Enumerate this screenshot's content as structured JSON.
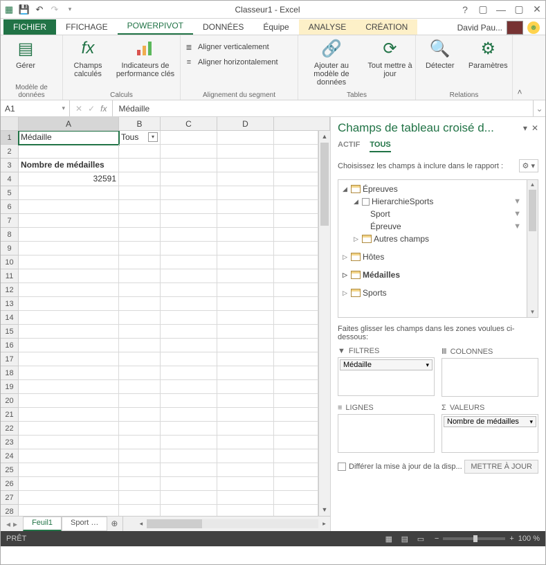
{
  "title": "Classeur1 - Excel",
  "account_name": "David Pau...",
  "tabs": {
    "file": "FICHIER",
    "affichage": "FFICHAGE",
    "powerpivot": "POWERPIVOT",
    "donnees": "DONNÉES",
    "equipe": "Équipe",
    "analyse": "ANALYSE",
    "creation": "CRÉATION"
  },
  "ribbon": {
    "manage": "Gérer",
    "group_model": "Modèle de données",
    "calc_fields": "Champs calculés",
    "kpi": "Indicateurs de performance clés",
    "group_calc": "Calculs",
    "align_v": "Aligner verticalement",
    "align_h": "Aligner horizontalement",
    "group_align": "Alignement du segment",
    "add_model": "Ajouter au modèle de données",
    "refresh_all": "Tout mettre à jour",
    "group_tables": "Tables",
    "detect": "Détecter",
    "params": "Paramètres",
    "group_rel": "Relations"
  },
  "namebox": "A1",
  "formula": "Médaille",
  "columns": [
    "A",
    "B",
    "C",
    "D"
  ],
  "rows": {
    "r1": {
      "A": "Médaille",
      "B": "Tous"
    },
    "r3": {
      "A": "Nombre de médailles"
    },
    "r4": {
      "A": "32591"
    }
  },
  "row_count": 28,
  "sheets": {
    "active": "Feuil1",
    "other": "Sport …"
  },
  "taskpane": {
    "title": "Champs de tableau croisé d...",
    "tab_actif": "ACTIF",
    "tab_tous": "TOUS",
    "hint": "Choisissez les champs à inclure dans le rapport :",
    "fields": {
      "epreuves": "Épreuves",
      "hierarchie": "HierarchieSports",
      "sport": "Sport",
      "epreuve": "Épreuve",
      "autres": "Autres champs",
      "hotes": "Hôtes",
      "medailles": "Médailles",
      "sports": "Sports"
    },
    "drag_hint": "Faites glisser les champs dans les zones voulues ci-dessous:",
    "zone_filters": "FILTRES",
    "zone_columns": "COLONNES",
    "zone_rows": "LIGNES",
    "zone_values": "VALEURS",
    "filter_item": "Médaille",
    "value_item": "Nombre de médailles",
    "defer": "Différer la mise à jour de la disp...",
    "update": "METTRE À JOUR"
  },
  "status": {
    "ready": "PRÊT",
    "zoom": "100 %"
  }
}
